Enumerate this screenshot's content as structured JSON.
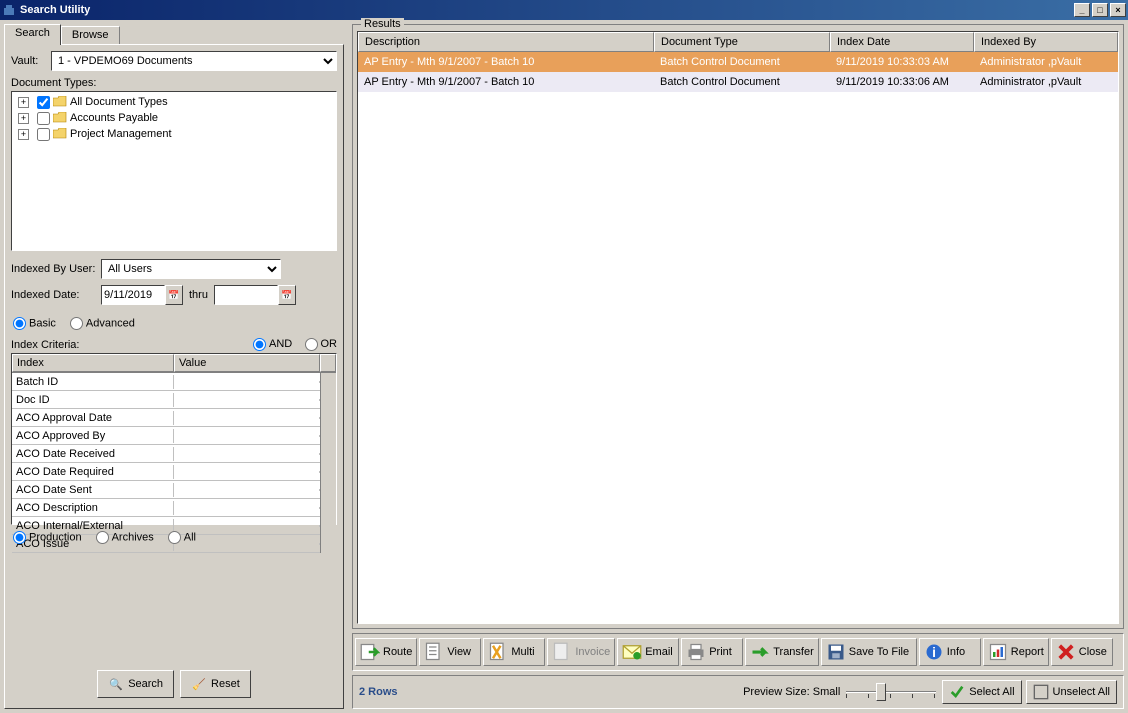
{
  "title": "Search Utility",
  "tabs": {
    "search": "Search",
    "browse": "Browse"
  },
  "vault": {
    "label": "Vault:",
    "value": "1 - VPDEMO69 Documents"
  },
  "docTypes": {
    "label": "Document Types:",
    "items": [
      {
        "label": "All Document Types",
        "checked": true
      },
      {
        "label": "Accounts Payable",
        "checked": false
      },
      {
        "label": "Project Management",
        "checked": false
      }
    ]
  },
  "indexedByUser": {
    "label": "Indexed By User:",
    "value": "All Users"
  },
  "indexedDate": {
    "label": "Indexed Date:",
    "from": "9/11/2019",
    "thru": "thru",
    "to": ""
  },
  "mode": {
    "basic": "Basic",
    "advanced": "Advanced"
  },
  "criteria": {
    "label": "Index Criteria:",
    "and": "AND",
    "or": "OR",
    "headers": {
      "index": "Index",
      "value": "Value"
    },
    "rows": [
      "Batch ID",
      "Doc ID",
      "ACO Approval Date",
      "ACO Approved By",
      "ACO Date Received",
      "ACO Date Required",
      "ACO Date Sent",
      "ACO Description",
      "ACO Internal/External",
      "ACO Issue"
    ]
  },
  "scope": {
    "production": "Production",
    "archives": "Archives",
    "all": "All"
  },
  "searchBtn": "Search",
  "resetBtn": "Reset",
  "results": {
    "legend": "Results",
    "headers": {
      "desc": "Description",
      "type": "Document Type",
      "date": "Index Date",
      "by": "Indexed By"
    },
    "rows": [
      {
        "desc": "AP Entry - Mth 9/1/2007 - Batch 10",
        "type": "Batch Control Document",
        "date": "9/11/2019 10:33:03 AM",
        "by": "Administrator ,pVault",
        "selected": true
      },
      {
        "desc": "AP Entry - Mth 9/1/2007 - Batch 10",
        "type": "Batch Control Document",
        "date": "9/11/2019 10:33:06 AM",
        "by": "Administrator ,pVault",
        "selected": false
      }
    ]
  },
  "toolbar": {
    "route": "Route",
    "view": "View",
    "multi": "Multi",
    "invoice": "Invoice",
    "email": "Email",
    "print": "Print",
    "transfer": "Transfer",
    "saveToFile": "Save To File",
    "info": "Info",
    "report": "Report",
    "close": "Close"
  },
  "status": {
    "rows": "2 Rows",
    "previewSize": "Preview Size: Small",
    "selectAll": "Select All",
    "unselectAll": "Unselect All"
  }
}
